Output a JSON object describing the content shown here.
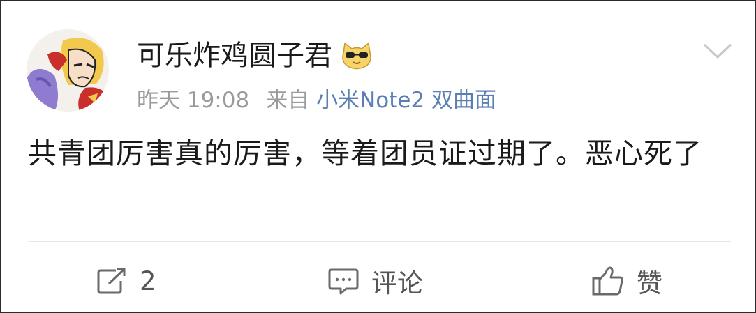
{
  "post": {
    "username": "可乐炸鸡圆子君",
    "badge_icon": "cool-cat-emoji-icon",
    "time": "昨天 19:08",
    "source_prefix": "来自",
    "source_device": "小米Note2 双曲面",
    "content": "共青团厉害真的厉害，等着团员证过期了。恶心死了"
  },
  "actions": {
    "repost_count": "2",
    "comment_label": "评论",
    "like_label": "赞"
  },
  "colors": {
    "source_link": "#5b7fb4",
    "meta_text": "#9a9a9a",
    "divider": "#e8e8e8"
  }
}
